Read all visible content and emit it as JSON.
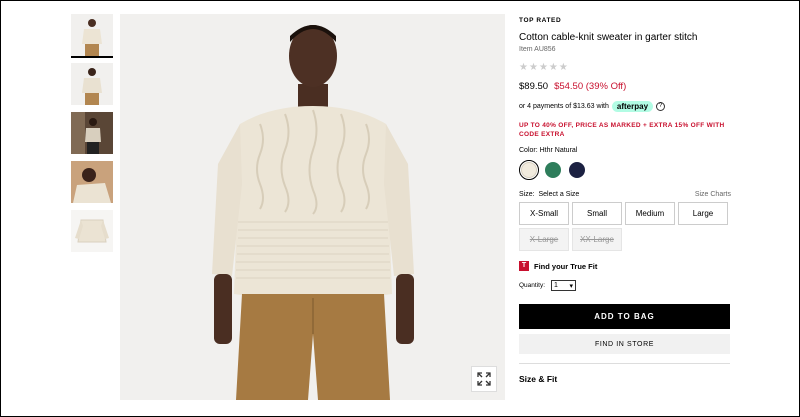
{
  "product": {
    "badge": "TOP RATED",
    "title": "Cotton cable-knit sweater in garter stitch",
    "item_number": "Item AU856",
    "rating_stars": 0,
    "price_original": "$89.50",
    "price_sale": "$54.50 (39% Off)",
    "afterpay_text": "or 4 payments of $13.63 with",
    "afterpay_logo": "afterpay",
    "promo": "UP TO 40% OFF, PRICE AS MARKED + EXTRA 15% OFF WITH CODE EXTRA",
    "color_label": "Color: Hthr Natural",
    "colors": [
      {
        "name": "Hthr Natural",
        "hex": "#f1ebde",
        "selected": true
      },
      {
        "name": "green",
        "hex": "#2e7d5b",
        "selected": false
      },
      {
        "name": "navy",
        "hex": "#1c2142",
        "selected": false
      }
    ],
    "size_label": "Size:",
    "size_selected_text": "Select a Size",
    "size_charts": "Size Charts",
    "sizes": [
      {
        "label": "X-Small",
        "available": true
      },
      {
        "label": "Small",
        "available": true
      },
      {
        "label": "Medium",
        "available": true
      },
      {
        "label": "Large",
        "available": true
      },
      {
        "label": "X-Large",
        "available": false
      },
      {
        "label": "XX-Large",
        "available": false
      }
    ],
    "truefit": "Find your True Fit",
    "truefit_icon": "T",
    "quantity_label": "Quantity:",
    "quantity_value": "1",
    "add_to_bag": "ADD TO BAG",
    "find_in_store": "FIND IN STORE",
    "size_fit_heading": "Size & Fit"
  },
  "colors": {
    "sale_red": "#c8102e",
    "afterpay_mint": "#b2fce4",
    "image_bg": "#f1f0ee"
  }
}
